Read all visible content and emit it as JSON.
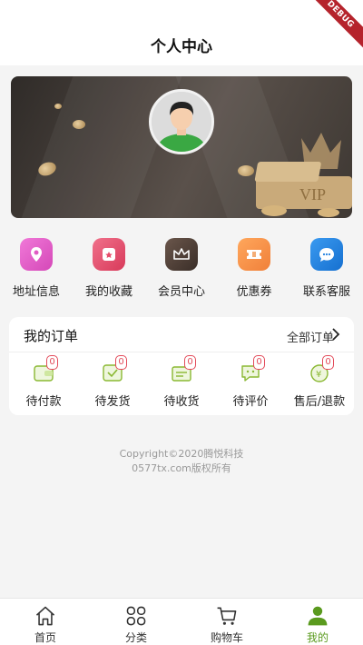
{
  "header": {
    "title": "个人中心"
  },
  "debug_ribbon": "DEBUG",
  "features": [
    {
      "label": "地址信息",
      "icon": "location-pin-icon",
      "color": "#e05bc4"
    },
    {
      "label": "我的收藏",
      "icon": "favorites-icon",
      "color": "#e64c6a"
    },
    {
      "label": "会员中心",
      "icon": "crown-icon",
      "color": "#4a3a33"
    },
    {
      "label": "优惠券",
      "icon": "coupon-icon",
      "color": "#f08a3c"
    },
    {
      "label": "联系客服",
      "icon": "chat-bubble-icon",
      "color": "#1f7fe0"
    }
  ],
  "orders": {
    "title": "我的订单",
    "all_label": "全部订单",
    "items": [
      {
        "label": "待付款",
        "count": "0",
        "icon": "wallet-icon"
      },
      {
        "label": "待发货",
        "count": "0",
        "icon": "package-check-icon"
      },
      {
        "label": "待收货",
        "count": "0",
        "icon": "delivery-box-icon"
      },
      {
        "label": "待评价",
        "count": "0",
        "icon": "comment-icon"
      },
      {
        "label": "售后/退款",
        "count": "0",
        "icon": "refund-icon"
      }
    ]
  },
  "copyright": {
    "line1": "Copyright©2020腾悦科技",
    "line2": "0577tx.com版权所有"
  },
  "tabbar": [
    {
      "label": "首页",
      "icon": "home-icon",
      "active": false
    },
    {
      "label": "分类",
      "icon": "category-grid-icon",
      "active": false
    },
    {
      "label": "购物车",
      "icon": "cart-icon",
      "active": false
    },
    {
      "label": "我的",
      "icon": "user-icon",
      "active": true
    }
  ],
  "colors": {
    "accent": "#5a9a1e",
    "badge": "#e34b5a",
    "order_icon": "#8ab832"
  }
}
